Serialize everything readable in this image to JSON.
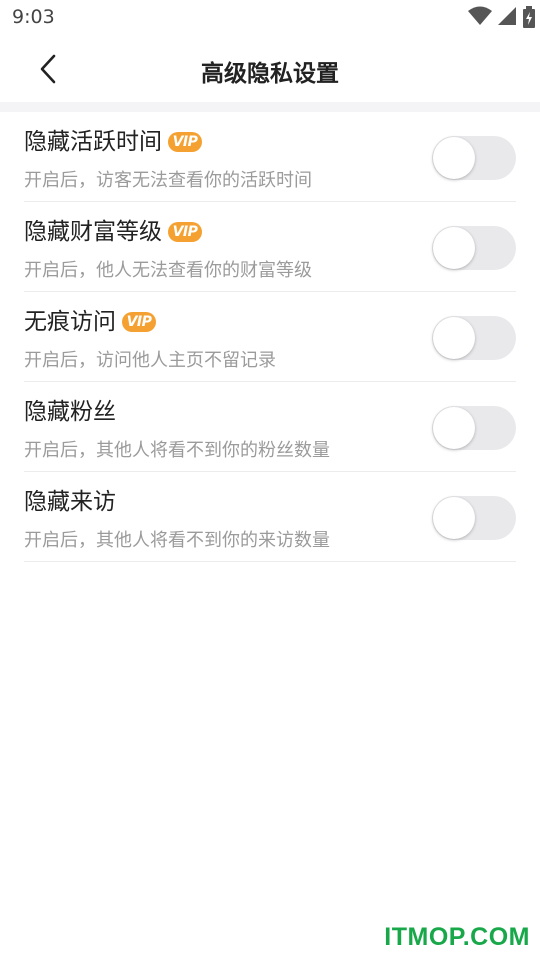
{
  "status_bar": {
    "time": "9:03",
    "icons": [
      "wifi-icon",
      "signal-icon",
      "battery-icon"
    ]
  },
  "header": {
    "title": "高级隐私设置",
    "back_icon": "chevron-left-icon"
  },
  "settings": [
    {
      "title": "隐藏活跃时间",
      "vip": true,
      "vip_label": "VIP",
      "description": "开启后，访客无法查看你的活跃时间",
      "enabled": false
    },
    {
      "title": "隐藏财富等级",
      "vip": true,
      "vip_label": "VIP",
      "description": "开启后，他人无法查看你的财富等级",
      "enabled": false
    },
    {
      "title": "无痕访问",
      "vip": true,
      "vip_label": "VIP",
      "description": "开启后，访问他人主页不留记录",
      "enabled": false
    },
    {
      "title": "隐藏粉丝",
      "vip": false,
      "description": "开启后，其他人将看不到你的粉丝数量",
      "enabled": false
    },
    {
      "title": "隐藏来访",
      "vip": false,
      "description": "开启后，其他人将看不到你的来访数量",
      "enabled": false
    }
  ],
  "colors": {
    "vip_badge": "#f5a132",
    "toggle_off": "#e9e9ec",
    "watermark": "#18a84a"
  },
  "watermark": "ITMOP.COM"
}
